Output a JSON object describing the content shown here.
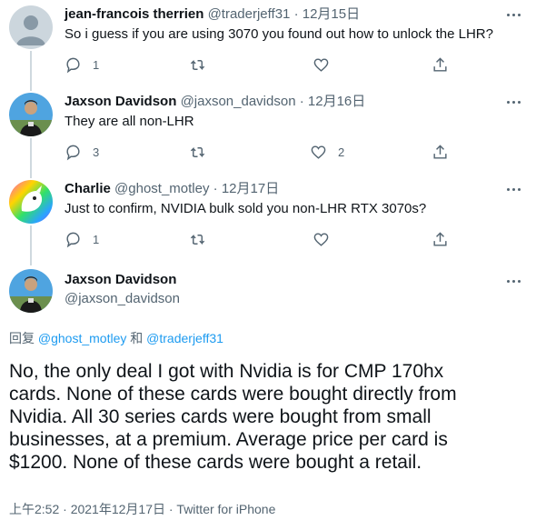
{
  "tweets": [
    {
      "name": "jean-francois therrien",
      "handle": "@traderjeff31",
      "dot": "·",
      "date": "12月15日",
      "text": "So i guess if you are using 3070 you found out how to unlock the LHR?",
      "replies": "1",
      "likes": ""
    },
    {
      "name": "Jaxson Davidson",
      "handle": "@jaxson_davidson",
      "dot": "·",
      "date": "12月16日",
      "text": "They are all non-LHR",
      "replies": "3",
      "likes": "2"
    },
    {
      "name": "Charlie",
      "handle": "@ghost_motley",
      "dot": "·",
      "date": "12月17日",
      "text": "Just to confirm, NVIDIA bulk sold you non-LHR RTX 3070s?",
      "replies": "1",
      "likes": ""
    }
  ],
  "main_tweet": {
    "name": "Jaxson Davidson",
    "handle": "@jaxson_davidson",
    "reply_prefix": "回复",
    "reply_user1": "@ghost_motley",
    "reply_and": "和",
    "reply_user2": "@traderjeff31",
    "lines": [
      "No, the only deal I got with Nvidia is for CMP 170hx",
      "cards. None of these cards were bought directly from",
      "Nvidia. All 30 series cards were bought from small",
      "businesses, at a premium. Average price per card is",
      "$1200. None of these cards were bought a retail."
    ],
    "meta": "上午2:52 · 2021年12月17日 · Twitter for iPhone"
  },
  "icons": {
    "reply": "reply-icon",
    "retweet": "retweet-icon",
    "like": "heart-icon",
    "share": "share-icon",
    "more": "more-icon"
  },
  "colors": {
    "link": "#1d9bf0",
    "secondary": "#536471",
    "thread_line": "#cfd9de"
  }
}
